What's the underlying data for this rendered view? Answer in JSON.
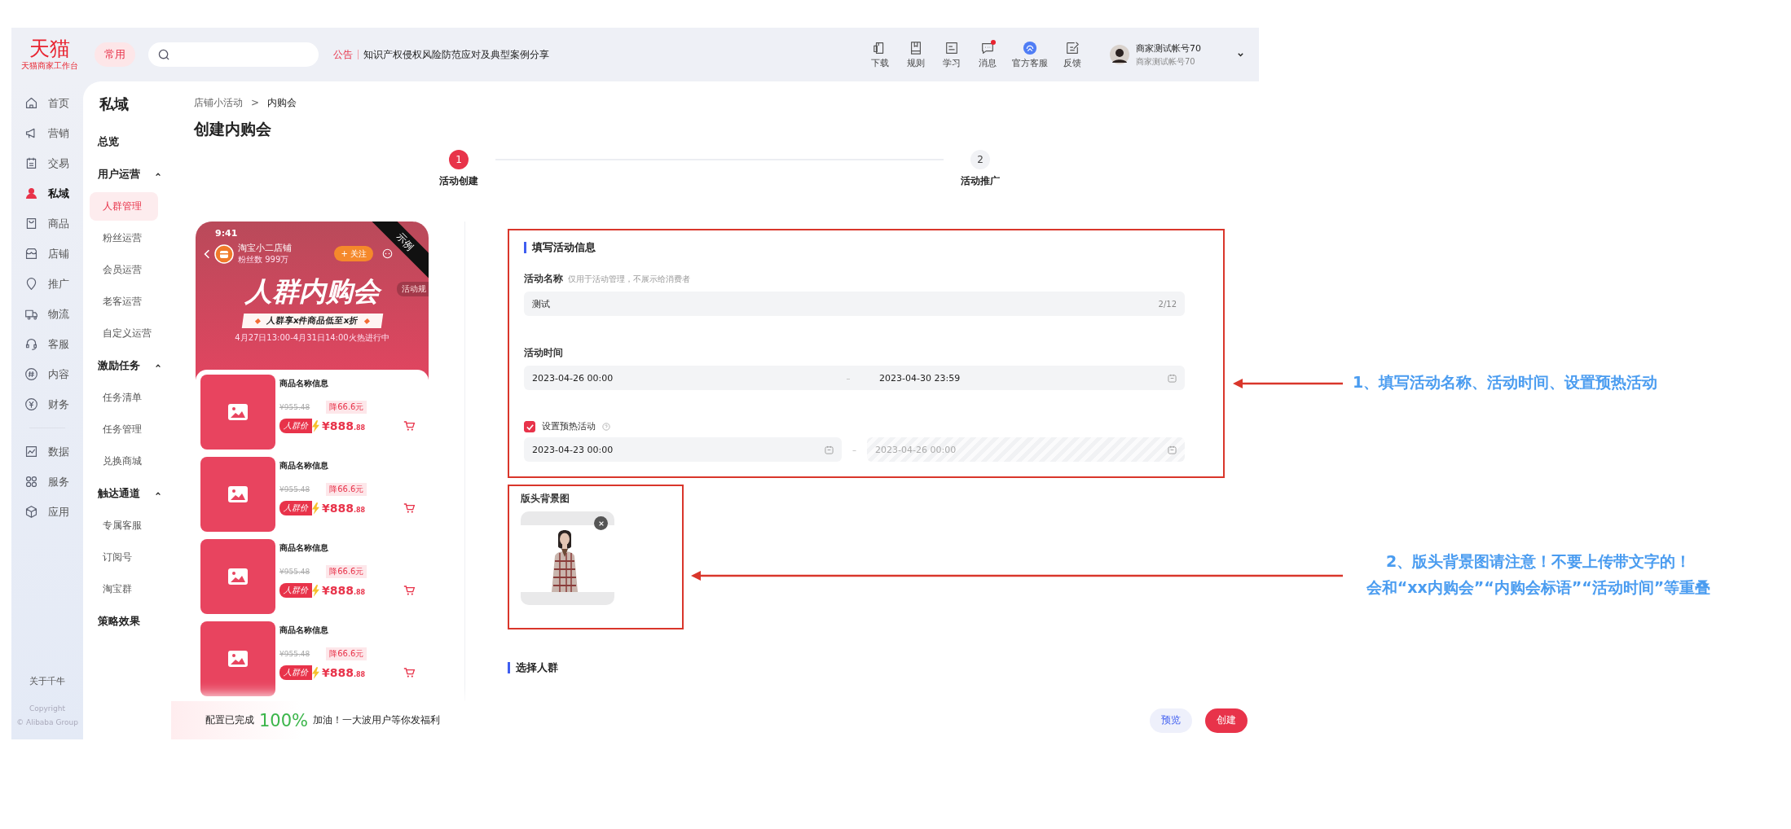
{
  "topbar": {
    "logo": "天猫",
    "logo_subtitle": "天猫商家工作台",
    "frequent_button": "常用",
    "notice": {
      "label": "公告",
      "text": "知识产权侵权风险防范应对及典型案例分享"
    },
    "tools": [
      {
        "label": "下载",
        "kind": "download",
        "badge": false
      },
      {
        "label": "规则",
        "kind": "rules",
        "badge": false
      },
      {
        "label": "学习",
        "kind": "learn",
        "badge": false
      },
      {
        "label": "消息",
        "kind": "message",
        "badge": true
      },
      {
        "label": "官方客服",
        "kind": "service",
        "badge": false
      },
      {
        "label": "反馈",
        "kind": "feedback",
        "badge": false
      }
    ],
    "account": {
      "name": "商家测试帐号70",
      "subname": "商家测试帐号70"
    }
  },
  "main_nav": {
    "groups": [
      {
        "items": [
          {
            "label": "首页",
            "kind": "home",
            "selected": false
          },
          {
            "label": "营销",
            "kind": "marketing",
            "selected": false
          },
          {
            "label": "交易",
            "kind": "trade",
            "selected": false
          },
          {
            "label": "私域",
            "kind": "private",
            "selected": true
          },
          {
            "label": "商品",
            "kind": "goods",
            "selected": false
          },
          {
            "label": "店铺",
            "kind": "shop",
            "selected": false
          },
          {
            "label": "推广",
            "kind": "promote",
            "selected": false
          },
          {
            "label": "物流",
            "kind": "logistics",
            "selected": false
          },
          {
            "label": "客服",
            "kind": "service",
            "selected": false
          },
          {
            "label": "内容",
            "kind": "content",
            "selected": false
          },
          {
            "label": "财务",
            "kind": "finance",
            "selected": false
          }
        ]
      },
      {
        "items": [
          {
            "label": "数据",
            "kind": "data",
            "selected": false
          },
          {
            "label": "服务",
            "kind": "services",
            "selected": false
          },
          {
            "label": "应用",
            "kind": "apps",
            "selected": false
          }
        ]
      }
    ],
    "about": "关于千牛",
    "copyright": "Copyright",
    "company": "© Alibaba Group"
  },
  "sub_nav": {
    "title": "私域",
    "sections": [
      {
        "label": "总览"
      },
      {
        "label": "用户运营",
        "expanded": true,
        "children": [
          {
            "label": "人群管理",
            "selected": true
          },
          {
            "label": "粉丝运营",
            "selected": false
          },
          {
            "label": "会员运营",
            "selected": false
          },
          {
            "label": "老客运营",
            "selected": false
          },
          {
            "label": "自定义运营",
            "selected": false
          }
        ]
      },
      {
        "label": "激励任务",
        "expanded": true,
        "children": [
          {
            "label": "任务清单",
            "selected": false
          },
          {
            "label": "任务管理",
            "selected": false
          },
          {
            "label": "兑换商城",
            "selected": false
          }
        ]
      },
      {
        "label": "触达通道",
        "expanded": true,
        "children": [
          {
            "label": "专属客服",
            "selected": false
          },
          {
            "label": "订阅号",
            "selected": false
          },
          {
            "label": "淘宝群",
            "selected": false
          }
        ]
      },
      {
        "label": "策略效果"
      }
    ]
  },
  "breadcrumb": {
    "items": [
      "店铺小活动",
      "内购会"
    ],
    "separator": ">"
  },
  "page_title": "创建内购会",
  "steps": [
    {
      "number": "1",
      "label": "活动创建",
      "selected": true
    },
    {
      "number": "2",
      "label": "活动推广",
      "selected": false
    }
  ],
  "preview": {
    "time": "9:41",
    "corner_tag": "示例",
    "shop_name": "淘宝小二店铺",
    "fans": "粉丝数 999万",
    "follow_button": "+ 关注",
    "title": "人群内购会",
    "rules_tag": "活动规",
    "slogan": "人群享x件商品低至x折",
    "time_range": "4月27日13:00-4月31日14:00火热进行中",
    "products": [
      {
        "name": "商品名称信息",
        "original_price": "¥955.48",
        "discount": "降66.6元",
        "price_tag": "人群价",
        "price": "¥888",
        "price_cents": ".88"
      },
      {
        "name": "商品名称信息",
        "original_price": "¥955.48",
        "discount": "降66.6元",
        "price_tag": "人群价",
        "price": "¥888",
        "price_cents": ".88"
      },
      {
        "name": "商品名称信息",
        "original_price": "¥955.48",
        "discount": "降66.6元",
        "price_tag": "人群价",
        "price": "¥888",
        "price_cents": ".88"
      },
      {
        "name": "商品名称信息",
        "original_price": "¥955.48",
        "discount": "降66.6元",
        "price_tag": "人群价",
        "price": "¥888",
        "price_cents": ".88"
      }
    ]
  },
  "form": {
    "section_title": "填写活动信息",
    "name_field": {
      "label": "活动名称",
      "hint": "仅用于活动管理，不展示给消费者",
      "value": "测试",
      "counter": "2/12"
    },
    "time_field": {
      "label": "活动时间",
      "start": "2023-04-26 00:00",
      "separator": "–",
      "end": "2023-04-30 23:59"
    },
    "preheat": {
      "label": "设置预热活动",
      "checked": true,
      "start": "2023-04-23 00:00",
      "separator": "–",
      "end": "2023-04-26 00:00",
      "end_disabled": true
    },
    "banner": {
      "label": "版头背景图"
    },
    "next_section_title": "选择人群"
  },
  "bottom_bar": {
    "progress_label": "配置已完成",
    "percent": "100%",
    "message": "加油！一大波用户等你发福利",
    "buttons": [
      {
        "label": "预览",
        "kind": "secondary"
      },
      {
        "label": "创建",
        "kind": "primary"
      }
    ]
  },
  "annotations": [
    {
      "lines": [
        "1、填写活动名称、活动时间、设置预热活动"
      ]
    },
    {
      "lines": [
        "2、版头背景图请注意！不要上传带文字的！",
        "会和“xx内购会”“内购会标语”“活动时间”等重叠"
      ]
    }
  ]
}
